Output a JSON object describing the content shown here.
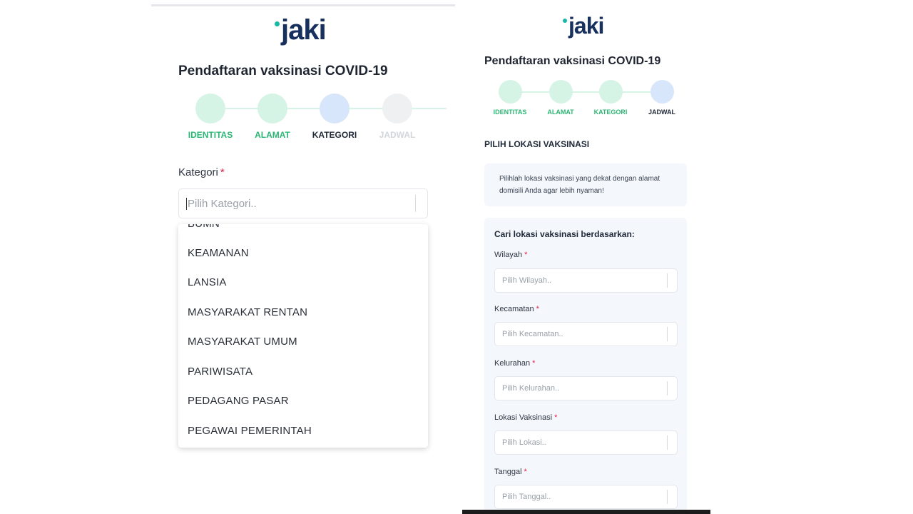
{
  "left": {
    "logo": "jaki",
    "title": "Pendaftaran vaksinasi COVID-19",
    "steps": [
      {
        "label": "IDENTITAS",
        "state": "done"
      },
      {
        "label": "ALAMAT",
        "state": "done"
      },
      {
        "label": "KATEGORI",
        "state": "active"
      },
      {
        "label": "JADWAL",
        "state": "todo"
      }
    ],
    "field": {
      "label": "Kategori",
      "required": "*",
      "placeholder": "Pilih Kategori.."
    },
    "options": [
      "BUMN",
      "KEAMANAN",
      "LANSIA",
      "MASYARAKAT RENTAN",
      "MASYARAKAT UMUM",
      "PARIWISATA",
      "PEDAGANG PASAR",
      "PEGAWAI PEMERINTAH"
    ]
  },
  "right": {
    "logo": "jaki",
    "title": "Pendaftaran vaksinasi COVID-19",
    "steps": [
      {
        "label": "IDENTITAS",
        "state": "done"
      },
      {
        "label": "ALAMAT",
        "state": "done"
      },
      {
        "label": "KATEGORI",
        "state": "done"
      },
      {
        "label": "JADWAL",
        "state": "active"
      }
    ],
    "section_title": "PILIH LOKASI VAKSINASI",
    "info_text": "Pilihlah lokasi vaksinasi yang dekat dengan alamat domisili Anda agar lebih nyaman!",
    "search_title": "Cari lokasi vaksinasi berdasarkan:",
    "fields": [
      {
        "label": "Wilayah",
        "required": "*",
        "placeholder": "Pilih Wilayah.."
      },
      {
        "label": "Kecamatan",
        "required": "*",
        "placeholder": "Pilih Kecamatan.."
      },
      {
        "label": "Kelurahan",
        "required": "*",
        "placeholder": "Pilih Kelurahan.."
      },
      {
        "label": "Lokasi Vaksinasi",
        "required": "*",
        "placeholder": "Pilih Lokasi.."
      },
      {
        "label": "Tanggal",
        "required": "*",
        "placeholder": "Pilih Tanggal.."
      }
    ]
  },
  "colors": {
    "brand_navy": "#17305e",
    "brand_teal": "#19b8a6",
    "step_done": "#2bb673",
    "step_active_bg": "#d8e6fb",
    "required": "#e11d48"
  }
}
